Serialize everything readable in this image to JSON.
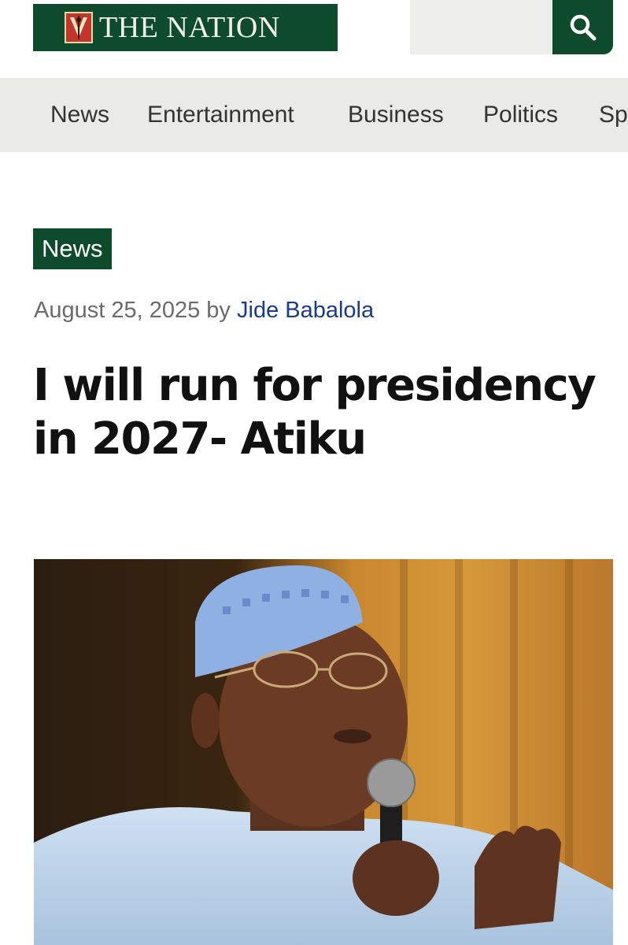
{
  "header": {
    "logo_text": "THE NATION",
    "search_placeholder": "",
    "colors": {
      "brand": "#0e4a2c",
      "logo_mark": "#c0362c"
    },
    "search_icon": "search-icon"
  },
  "nav": {
    "items": [
      {
        "label": "News"
      },
      {
        "label": "Entertainment"
      },
      {
        "label": "Business"
      },
      {
        "label": "Politics"
      },
      {
        "label": "Sp"
      }
    ]
  },
  "article": {
    "category": "News",
    "date": "August 25, 2025",
    "by": "by",
    "author": "Jide Babalola",
    "headline": "I will run for presidency in 2027- Atiku",
    "image_description": ""
  }
}
